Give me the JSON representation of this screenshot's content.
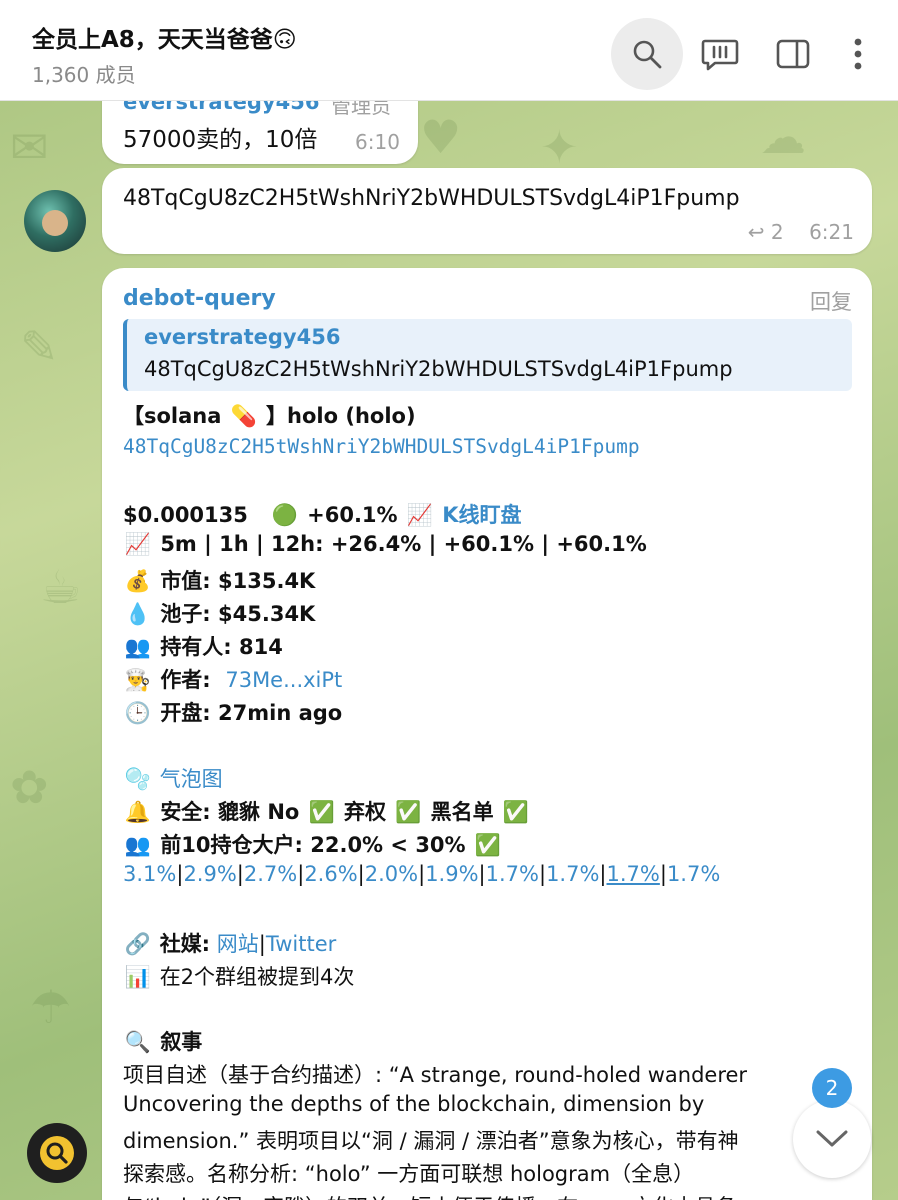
{
  "header": {
    "title": "全员上A8，天天当爸爸🙃",
    "member_count": "1,360 成员"
  },
  "messages": [
    {
      "sender": "everstrategy456",
      "role": "管理员",
      "text": "57000卖的，10倍",
      "time": "6:10"
    },
    {
      "text": "48TqCgU8zC2H5tWshNriY2bWHDULSTSvdgL4iP1Fpump",
      "reply_count": "2",
      "time": "6:21"
    },
    {
      "sender": "debot-query",
      "reply_label": "回复",
      "quote_sender": "everstrategy456",
      "quote_text": "48TqCgU8zC2H5tWshNriY2bWHDULSTSvdgL4iP1Fpump",
      "token_line_prefix": "【solana",
      "token_line_suffix": "】holo (holo)",
      "contract": "48TqCgU8zC2H5tWshNriY2bWHDULSTSvdgL4iP1Fpump",
      "price": "$0.000135",
      "price_change": "+60.1%",
      "kline_link": "K线盯盘",
      "timeframes": "5m | 1h | 12h: +26.4%  | +60.1%  | +60.1%",
      "market_cap": "市值: $135.4K",
      "pool": "池子: $45.34K",
      "holders": "持有人: 814",
      "author_label": "作者:",
      "author_link": "73Me...xiPt",
      "opened": "开盘: 27min ago",
      "bubble_map": "气泡图",
      "safety_label": "安全: 貔貅 No",
      "renounced": "弃权",
      "blacklist": "黑名单",
      "top10": "前10持仓大户: 22.0% < 30%",
      "holder_percents": [
        "3.1%",
        "2.9%",
        "2.7%",
        "2.6%",
        "2.0%",
        "1.9%",
        "1.7%",
        "1.7%",
        "1.7%",
        "1.7%"
      ],
      "social_label": "社媒:",
      "website_link": "网站",
      "twitter_link": "Twitter",
      "mentions": "在2个群组被提到4次",
      "narrative_title": "叙事",
      "narrative_1": "项目自述（基于合约描述）: “A strange, round-holed wanderer",
      "narrative_2": "Uncovering the depths of the blockchain, dimension by",
      "narrative_3": "dimension.” 表明项目以“洞 / 漏洞 / 漂泊者”意象为核心，带有神",
      "narrative_4": "探索感。名称分析: “holo” 一方面可联想 hologram（全息）",
      "narrative_5": "与“hole”（洞、空隙）的双关，短小便于传播。在 ...... 文化中具备"
    }
  ],
  "unread_count": "2"
}
